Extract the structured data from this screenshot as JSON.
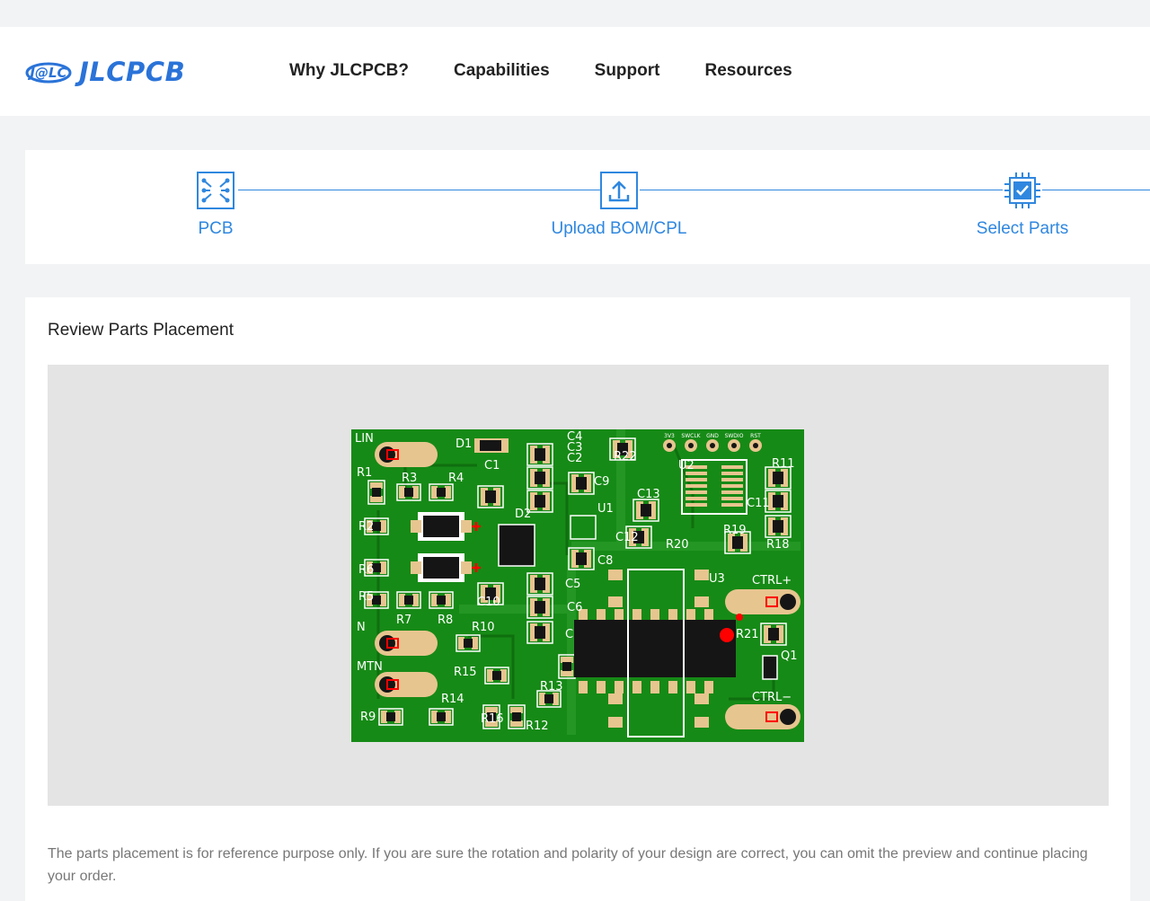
{
  "header": {
    "logo_text": "JLCPCB",
    "logo_badge": "J@LC",
    "nav": [
      "Why JLCPCB?",
      "Capabilities",
      "Support",
      "Resources"
    ]
  },
  "steps": [
    {
      "label": "PCB",
      "icon": "pcb-icon"
    },
    {
      "label": "Upload BOM/CPL",
      "icon": "upload-icon"
    },
    {
      "label": "Select Parts",
      "icon": "chip-check-icon"
    }
  ],
  "review": {
    "title": "Review Parts Placement",
    "note": "The parts placement is for reference purpose only. If you are sure the rotation and polarity of your design are correct, you can omit the preview and continue placing your order."
  },
  "board": {
    "pads_header": [
      "3V3",
      "SWCLK",
      "GND",
      "SWDIO",
      "RST"
    ],
    "refs": [
      "LIN",
      "D1",
      "C4",
      "C3",
      "C2",
      "R22",
      "U2",
      "R11",
      "R1",
      "R3",
      "R4",
      "C1",
      "C9",
      "C13",
      "C11",
      "R2",
      "D2",
      "U1",
      "R19",
      "R18",
      "C12",
      "R20",
      "C8",
      "R6",
      "C5",
      "U3",
      "CTRL+",
      "R5",
      "C10",
      "C6",
      "R7",
      "R8",
      "R10",
      "C",
      "R21",
      "N",
      "Q1",
      "MTN",
      "R15",
      "R13",
      "CTRL−",
      "R14",
      "R9",
      "R16",
      "R12"
    ],
    "colors": {
      "pcb": "#168a16",
      "silk": "#ffffff",
      "pad": "#e7c58f",
      "body": "#151515",
      "marker": "#ff0000"
    }
  }
}
